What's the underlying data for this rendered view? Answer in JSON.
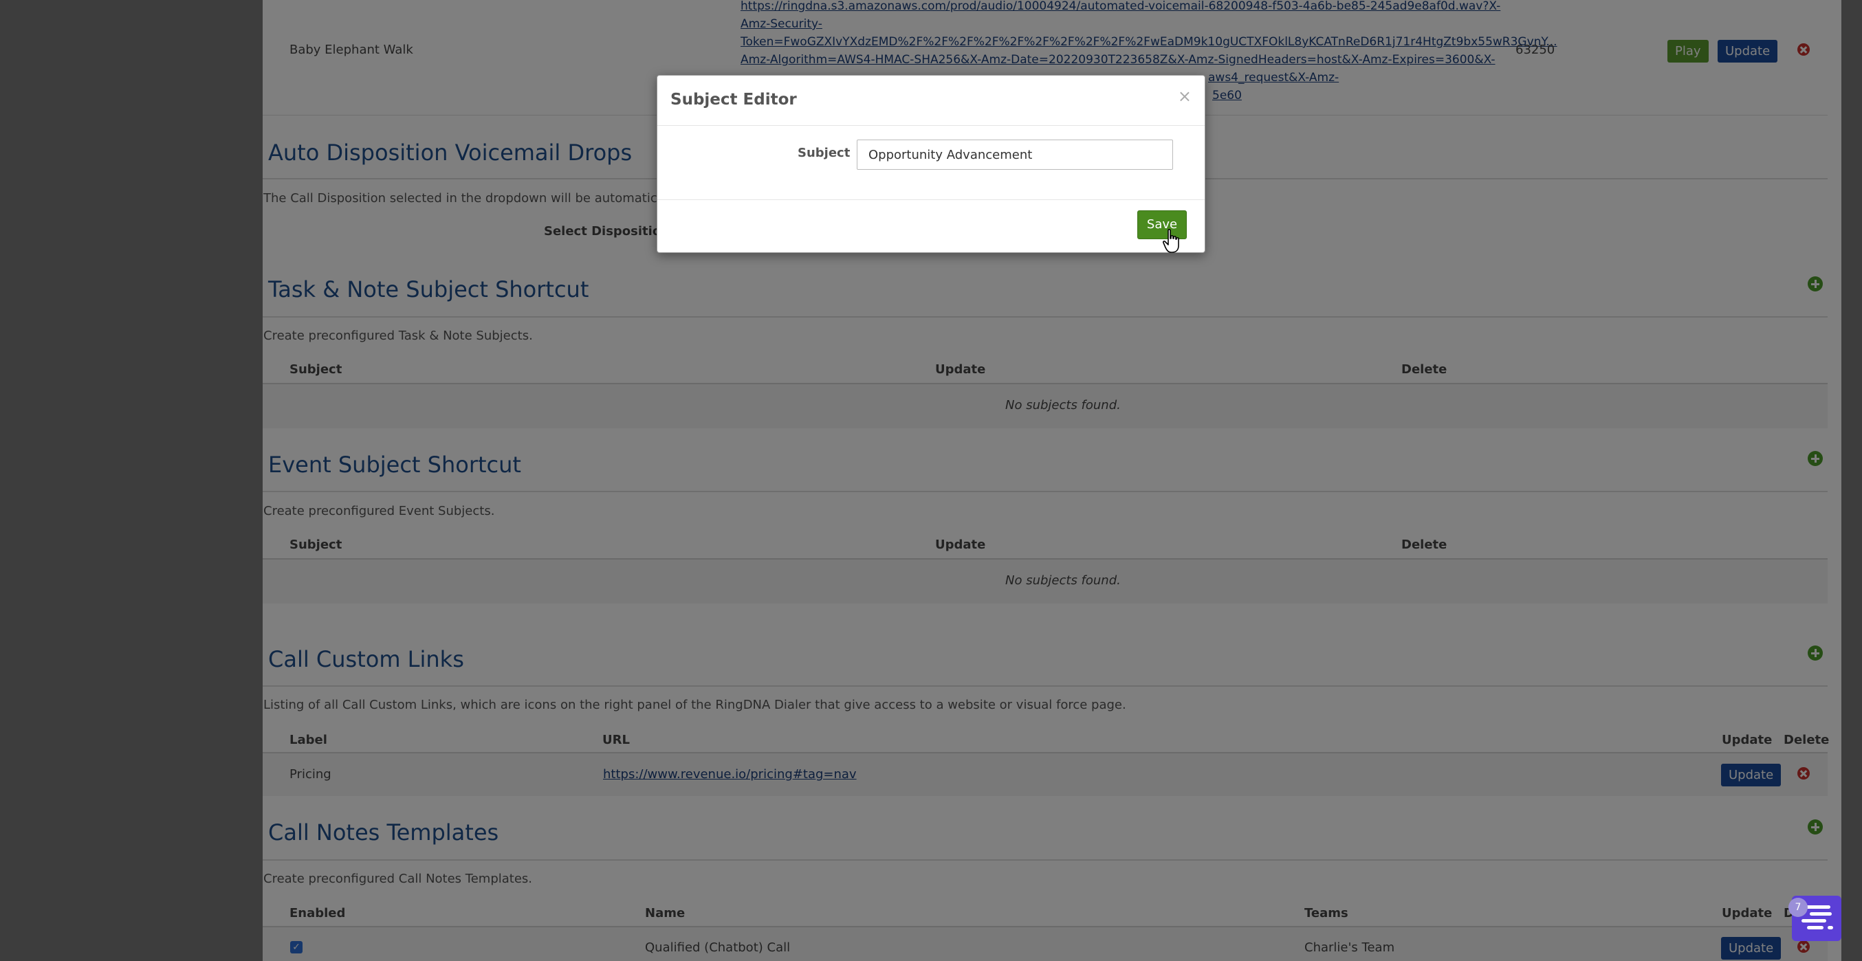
{
  "top_row": {
    "name": "Baby Elephant Walk",
    "url_lines": [
      "https://ringdna.s3.amazonaws.com/prod/audio/10004924/automated-voicemail-68200948-f503-4a6b-be85-245ad9e8af0d.wav?X-",
      "Amz-Security-",
      "Token=FwoGZXIvYXdzEMD%2F%2F%2F%2F%2F%2F%2F%2F%2F%2FwEaDM9k10gUCTXFOklL8yKCATnReD6R1j71r4HtgZt9bx55wR3GvnY...",
      "Amz-Algorithm=AWS4-HMAC-SHA256&X-Amz-Date=20220930T223658Z&X-Amz-SignedHeaders=host&X-Amz-Expires=3600&X-",
      "aws4_request&X-Amz-",
      "5e60"
    ],
    "size": "63250",
    "play_label": "Play",
    "update_label": "Update"
  },
  "auto_disposition": {
    "title": "Auto Disposition Voicemail Drops",
    "description": "The Call Disposition selected in the dropdown will be automatically app",
    "select_label": "Select Disposition"
  },
  "task_note": {
    "title": "Task & Note Subject Shortcut",
    "description": "Create preconfigured Task & Note Subjects.",
    "columns": [
      "Subject",
      "Update",
      "Delete"
    ],
    "empty": "No subjects found."
  },
  "event_subject": {
    "title": "Event Subject Shortcut",
    "description": "Create preconfigured Event Subjects.",
    "columns": [
      "Subject",
      "Update",
      "Delete"
    ],
    "empty": "No subjects found."
  },
  "custom_links": {
    "title": "Call Custom Links",
    "description": "Listing of all Call Custom Links, which are icons on the right panel of the RingDNA Dialer that give access to a website or visual force page.",
    "columns": [
      "Label",
      "URL",
      "Update",
      "Delete"
    ],
    "rows": [
      {
        "label": "Pricing",
        "url": "https://www.revenue.io/pricing#tag=nav",
        "update": "Update"
      }
    ]
  },
  "notes_templates": {
    "title": "Call Notes Templates",
    "description": "Create preconfigured Call Notes Templates.",
    "columns": [
      "Enabled",
      "Name",
      "Teams",
      "Update",
      "D"
    ],
    "rows": [
      {
        "name": "Qualified (Chatbot) Call",
        "teams": "Charlie's Team",
        "update": "Update"
      }
    ]
  },
  "modal": {
    "title": "Subject Editor",
    "close": "×",
    "subject_label": "Subject",
    "subject_value": "Opportunity Advancement",
    "save_label": "Save"
  },
  "chat_widget": {
    "badge": "7"
  },
  "colors": {
    "heading": "#1f4e8c",
    "update_button": "#1a4b9b",
    "play_button": "#5a9a2e",
    "save_button": "#4a8b1f",
    "delete_icon": "#c9302c",
    "add_icon": "#4d9a2a",
    "chat_widget": "#5b3fd6"
  }
}
